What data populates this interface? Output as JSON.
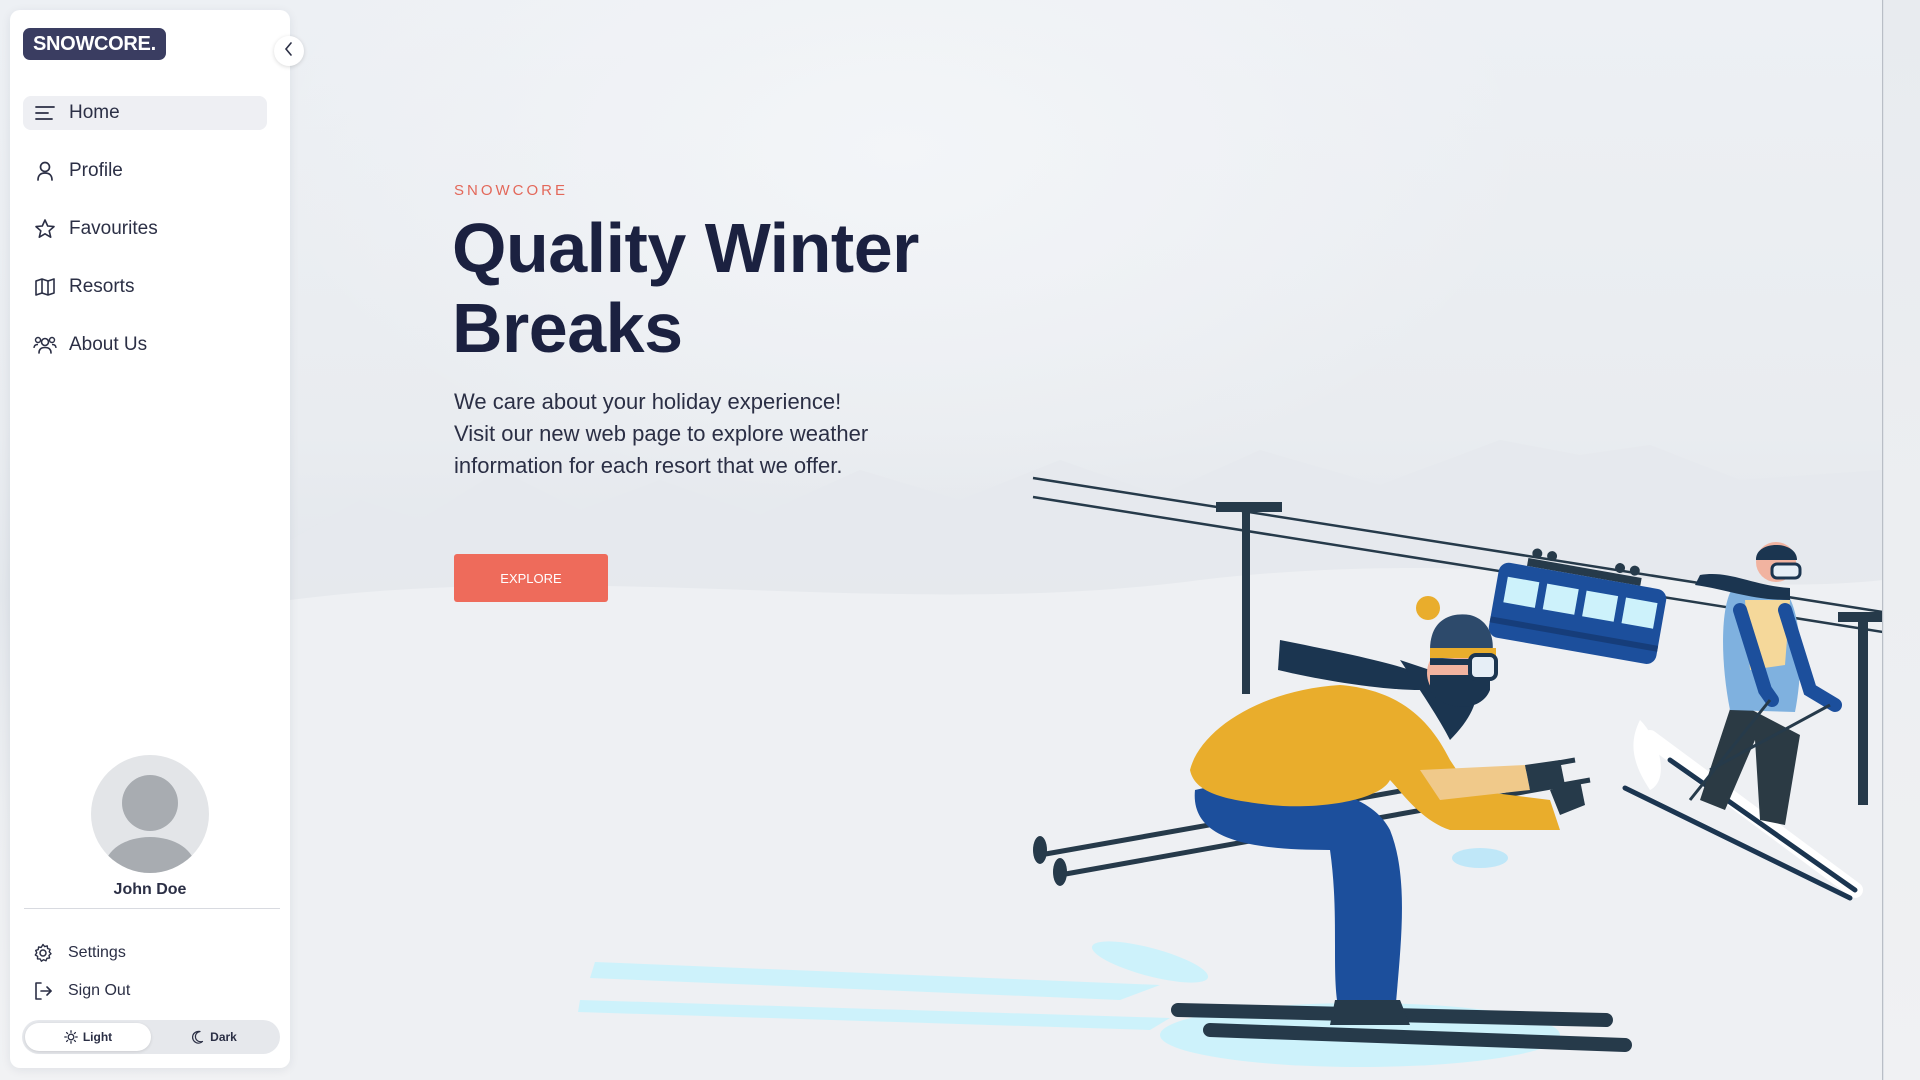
{
  "brand": {
    "logo_text": "SNOWCORE."
  },
  "nav": {
    "items": [
      {
        "label": "Home",
        "icon": "menu-icon"
      },
      {
        "label": "Profile",
        "icon": "user-icon"
      },
      {
        "label": "Favourites",
        "icon": "star-icon"
      },
      {
        "label": "Resorts",
        "icon": "map-icon"
      },
      {
        "label": "About Us",
        "icon": "users-icon"
      }
    ],
    "active": "Home"
  },
  "user": {
    "name": "John Doe"
  },
  "bottom": {
    "settings_label": "Settings",
    "signout_label": "Sign Out"
  },
  "theme": {
    "light_label": "Light",
    "dark_label": "Dark",
    "selected": "Light"
  },
  "hero": {
    "eyebrow": "SNOWCORE",
    "headline_line1": "Quality Winter",
    "headline_line2": "Breaks",
    "lead_line1": "We care about your holiday experience!",
    "lead_line2": "Visit our new web page to explore weather",
    "lead_line3": "information for each resort that we offer.",
    "cta_label": "EXPLORE"
  },
  "colors": {
    "brand_dark": "#3a3d61",
    "accent": "#ee6b5b",
    "heading": "#1b2140"
  }
}
